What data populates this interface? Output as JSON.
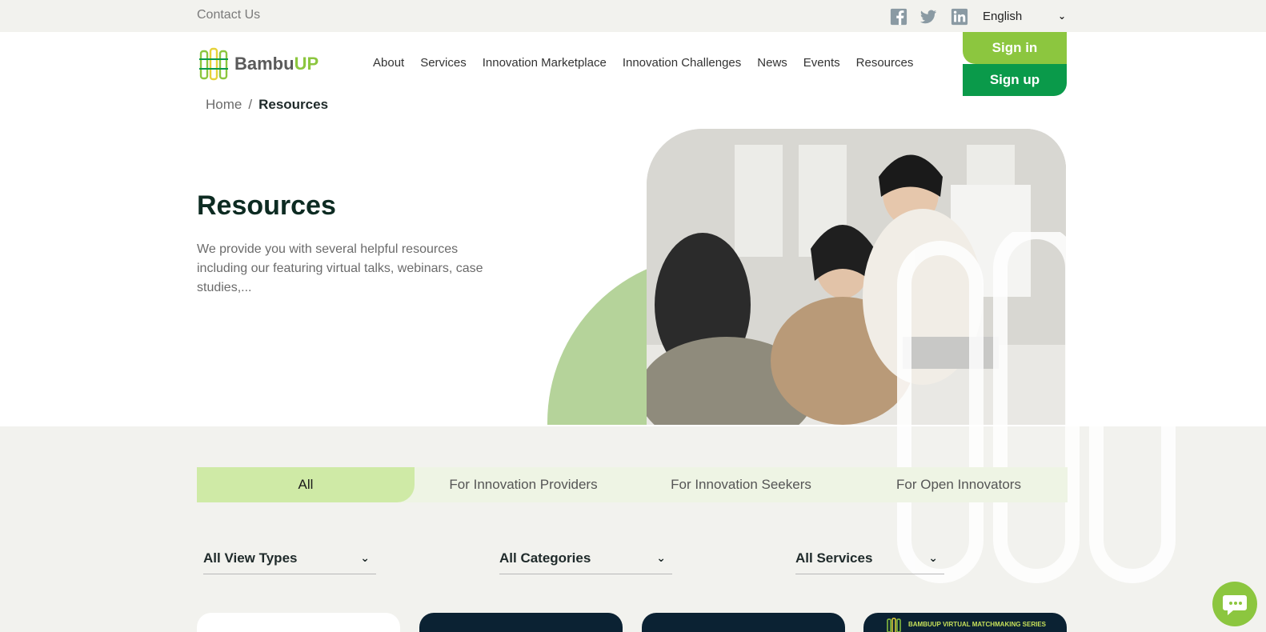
{
  "topbar": {
    "contact_label": "Contact Us",
    "language": "English",
    "social": [
      "facebook-icon",
      "twitter-icon",
      "linkedin-icon"
    ]
  },
  "brand": {
    "name_part1": "Bambu",
    "name_part2": "UP",
    "accent": "#8cc63f",
    "dark_green": "#0a9a4a"
  },
  "nav": {
    "items": [
      "About",
      "Services",
      "Innovation Marketplace",
      "Innovation Challenges",
      "News",
      "Events",
      "Resources"
    ]
  },
  "auth": {
    "signin_label": "Sign in",
    "signup_label": "Sign up"
  },
  "breadcrumb": {
    "home": "Home",
    "separator": "/",
    "current": "Resources"
  },
  "hero": {
    "title": "Resources",
    "description": "We provide you with several helpful resources including our featuring virtual talks, webinars, case studies,..."
  },
  "tabs": {
    "items": [
      "All",
      "For Innovation Providers",
      "For Innovation Seekers",
      "For Open Innovators"
    ],
    "active_index": 0
  },
  "filters": {
    "view_types": "All View Types",
    "categories": "All Categories",
    "services": "All Services"
  },
  "cards": {
    "card4_caption": "BAMBUUP VIRTUAL MATCHMAKING SERIES"
  },
  "chat": {
    "icon": "chat-bubble-icon"
  }
}
